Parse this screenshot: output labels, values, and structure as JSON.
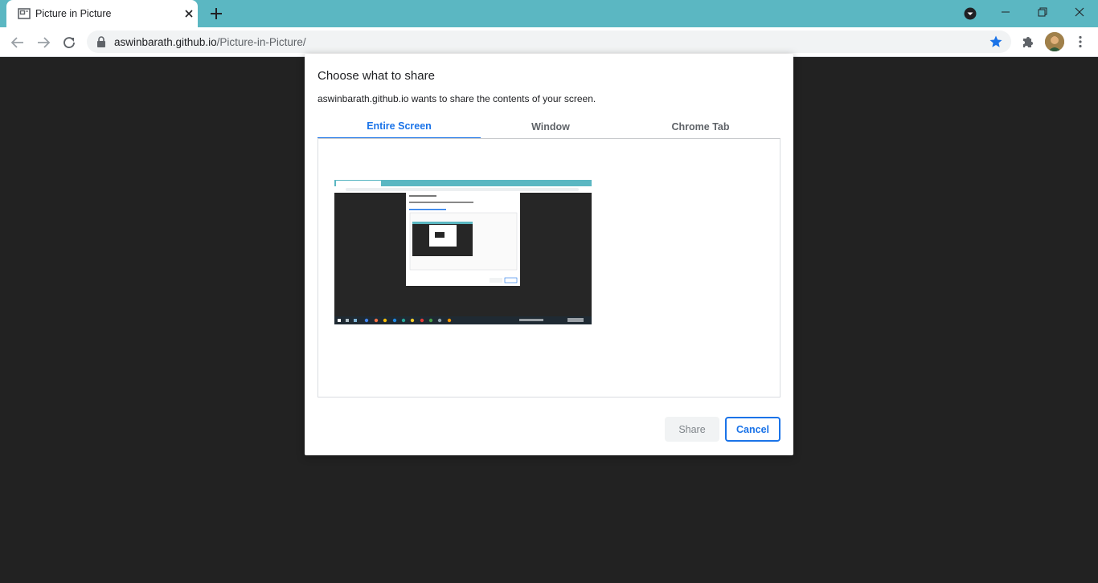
{
  "browser": {
    "tab_title": "Picture in Picture",
    "url_host": "aswinbarath.github.io",
    "url_path": "/Picture-in-Picture/",
    "accent_color": "#5bb7c2"
  },
  "dialog": {
    "title": "Choose what to share",
    "description": "aswinbarath.github.io wants to share the contents of your screen.",
    "tabs": [
      {
        "label": "Entire Screen",
        "selected": true
      },
      {
        "label": "Window",
        "selected": false
      },
      {
        "label": "Chrome Tab",
        "selected": false
      }
    ],
    "share_label": "Share",
    "cancel_label": "Cancel",
    "accent_color": "#1a73e8"
  },
  "icons": {
    "favicon": "picture-in-picture-icon",
    "tab_close": "close-icon",
    "new_tab": "plus-icon",
    "tab_search": "chevron-down-icon",
    "lock": "lock-icon",
    "bookmark": "star-icon",
    "extensions": "puzzle-icon",
    "menu": "more-vert-icon"
  }
}
